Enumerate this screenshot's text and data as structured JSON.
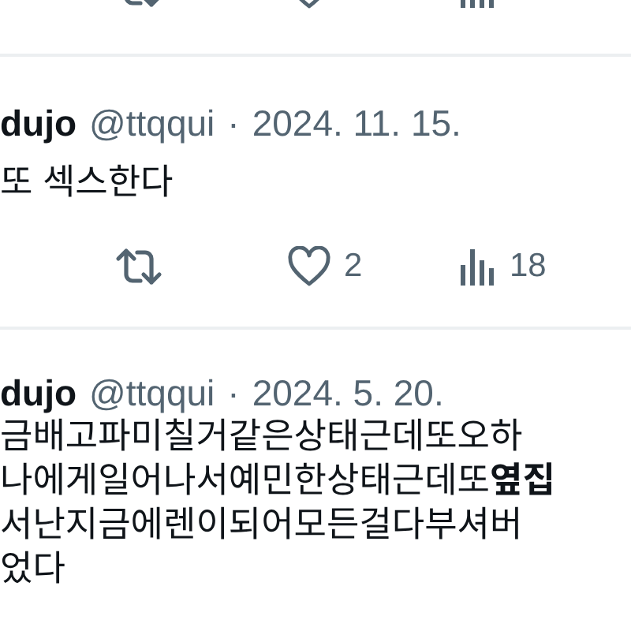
{
  "partial_tweet": {
    "actions": [
      {
        "kind": "retweet"
      },
      {
        "kind": "like"
      },
      {
        "kind": "views"
      }
    ]
  },
  "tweets": [
    {
      "name": "dujo",
      "handle": "@ttqqui",
      "separator": "·",
      "date": "2024. 11. 15.",
      "lines": [
        "또 섹스한다"
      ],
      "actions": [
        {
          "kind": "retweet"
        },
        {
          "kind": "like",
          "count": "2"
        },
        {
          "kind": "views",
          "count": "18"
        }
      ]
    },
    {
      "name": "dujo",
      "handle": "@ttqqui",
      "separator": "·",
      "date": "2024. 5. 20.",
      "lines": [
        "금배고파미칠거같은상태근데또오하",
        "나에게일어나서예민한상태근데또**옆집**",
        "서난지금에렌이되어모든걸다부셔버",
        "었다"
      ]
    }
  ]
}
